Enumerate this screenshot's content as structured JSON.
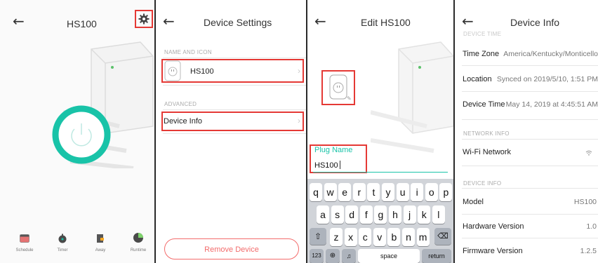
{
  "panel1": {
    "title": "HS100",
    "bottom_nav": [
      {
        "label": "Schedule",
        "icon": "calendar-icon"
      },
      {
        "label": "Timer",
        "icon": "stopwatch-icon"
      },
      {
        "label": "Away",
        "icon": "away-icon"
      },
      {
        "label": "Runtime",
        "icon": "pie-chart-icon"
      }
    ],
    "accent": "#19c3a8"
  },
  "panel2": {
    "title": "Device Settings",
    "section_name_icon": "NAME AND ICON",
    "device_name": "HS100",
    "section_advanced": "ADVANCED",
    "device_info_label": "Device Info",
    "remove_label": "Remove Device",
    "remove_color": "#f36c6c"
  },
  "panel3": {
    "title": "Edit HS100",
    "field_label": "Plug Name",
    "field_value": "HS100",
    "keyboard": {
      "row1": [
        "q",
        "w",
        "e",
        "r",
        "t",
        "y",
        "u",
        "i",
        "o",
        "p"
      ],
      "row2": [
        "a",
        "s",
        "d",
        "f",
        "g",
        "h",
        "j",
        "k",
        "l"
      ],
      "row3": [
        "z",
        "x",
        "c",
        "v",
        "b",
        "n",
        "m"
      ],
      "numbers_key": "123",
      "space_key": "space",
      "return_key": "return"
    }
  },
  "panel4": {
    "title": "Device Info",
    "top_label_partial": "DEVICE TIME",
    "rows_time": [
      {
        "label": "Time Zone",
        "value": "America/Kentucky/Monticello"
      },
      {
        "label": "Location",
        "value": "Synced on 2019/5/10, 1:51 PM"
      },
      {
        "label": "Device Time",
        "value": "May 14, 2019 at 4:45:51 AM"
      }
    ],
    "section_network": "NETWORK INFO",
    "wifi_label": "Wi-Fi Network",
    "section_device": "DEVICE INFO",
    "rows_device": [
      {
        "label": "Model",
        "value": "HS100"
      },
      {
        "label": "Hardware Version",
        "value": "1.0"
      },
      {
        "label": "Firmware Version",
        "value": "1.2.5"
      }
    ]
  }
}
